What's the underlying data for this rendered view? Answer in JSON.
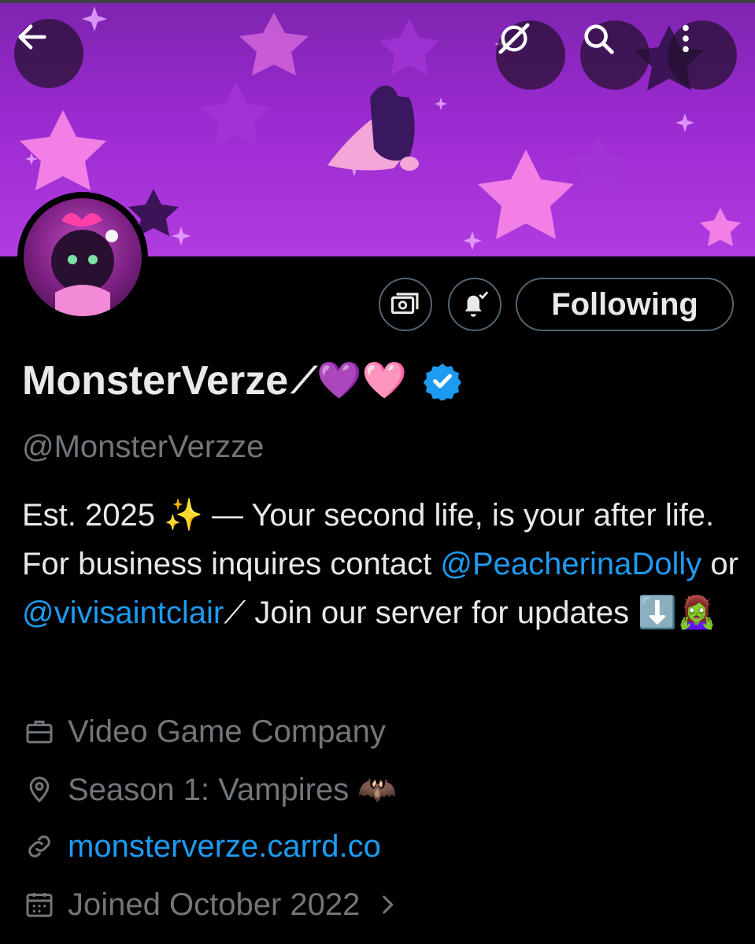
{
  "profile": {
    "display_name": "MonsterVerze",
    "name_decoration": "⟋💜🩷",
    "handle": "@MonsterVerzze",
    "verified": true,
    "follow_button_label": "Following"
  },
  "bio": {
    "part1": "Est. 2025 ✨ — Your second life, is your after life. For business inquires contact ",
    "mention1": "@PeacherinaDolly",
    "part2": " or ",
    "mention2": "@vivisaintclair",
    "part3": "⟋ Join our server for updates ⬇️🧟‍♀️"
  },
  "meta": {
    "category": "Video Game Company",
    "location": "Season 1: Vampires 🦇",
    "website": "monsterverze.carrd.co",
    "joined": "Joined October 2022"
  },
  "icons": {
    "back": "arrow-left-icon",
    "grok": "grok-icon",
    "search": "search-icon",
    "more": "more-vertical-icon",
    "subscribe": "money-icon",
    "notifications": "bell-check-icon",
    "category": "briefcase-icon",
    "location": "location-pin-icon",
    "website": "link-icon",
    "joined": "calendar-icon",
    "joined_arrow": "chevron-right-icon",
    "verified": "verified-badge-icon"
  },
  "colors": {
    "background": "#000000",
    "text": "#e7e9ea",
    "secondary_text": "#71767b",
    "link": "#1d9bf0",
    "verified": "#1d9bf0",
    "banner": "#9a2ad0"
  }
}
